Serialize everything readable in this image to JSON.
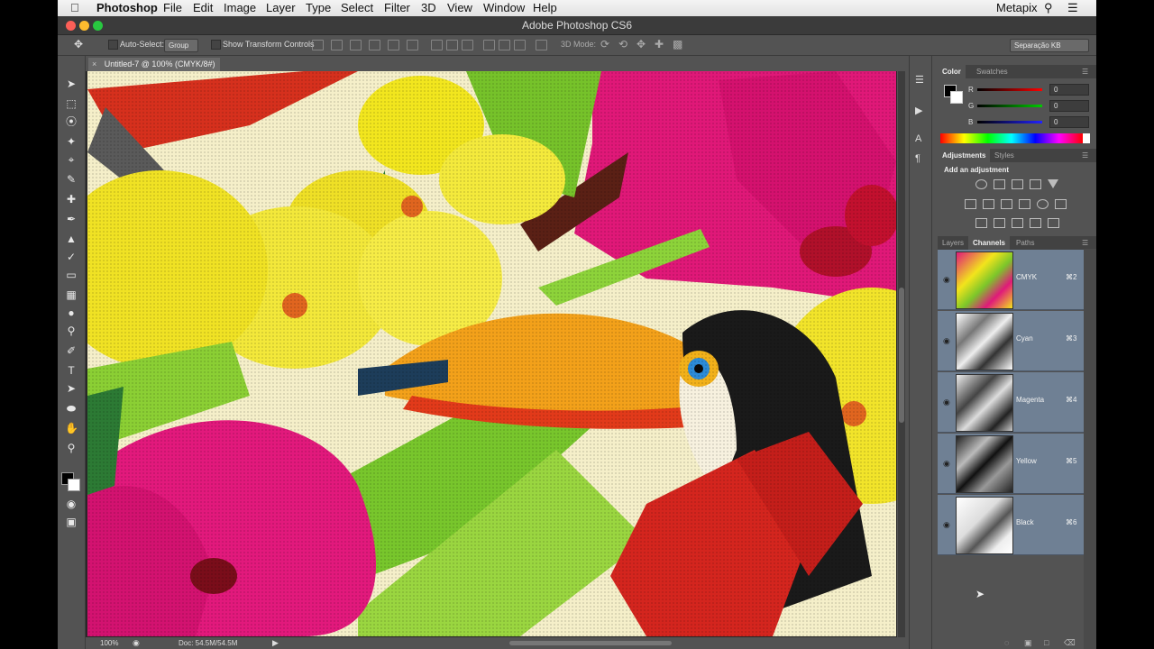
{
  "menubar": {
    "app_name": "Photoshop",
    "items": [
      "File",
      "Edit",
      "Image",
      "Layer",
      "Type",
      "Select",
      "Filter",
      "3D",
      "View",
      "Window",
      "Help"
    ],
    "right_label": "Metapix"
  },
  "window": {
    "title": "Adobe Photoshop CS6"
  },
  "options_bar": {
    "auto_select_label": "Auto-Select:",
    "auto_select_value": "Group",
    "transform_label": "Show Transform Controls",
    "mode_label": "3D Mode:",
    "workspace_value": "Separação KB"
  },
  "document": {
    "tab_label": "Untitled-7 @ 100% (CMYK/8#)",
    "zoom": "100%",
    "doc_size": "Doc: 54.5M/54.5M"
  },
  "color_panel": {
    "tabs": [
      "Color",
      "Swatches"
    ],
    "channels": [
      {
        "label": "R",
        "value": "0"
      },
      {
        "label": "G",
        "value": "0"
      },
      {
        "label": "B",
        "value": "0"
      }
    ]
  },
  "adjustments_panel": {
    "tabs": [
      "Adjustments",
      "Styles"
    ],
    "heading": "Add an adjustment"
  },
  "channels_panel": {
    "tabs": [
      "Layers",
      "Channels",
      "Paths"
    ],
    "channels": [
      {
        "name": "CMYK",
        "shortcut": "⌘2"
      },
      {
        "name": "Cyan",
        "shortcut": "⌘3"
      },
      {
        "name": "Magenta",
        "shortcut": "⌘4"
      },
      {
        "name": "Yellow",
        "shortcut": "⌘5"
      },
      {
        "name": "Black",
        "shortcut": "⌘6"
      }
    ]
  },
  "colors": {
    "app_bg": "#535353",
    "selected_row": "#6f8094",
    "magenta": "#e0197a",
    "yellow": "#f2e41c",
    "green": "#7cc62a"
  }
}
